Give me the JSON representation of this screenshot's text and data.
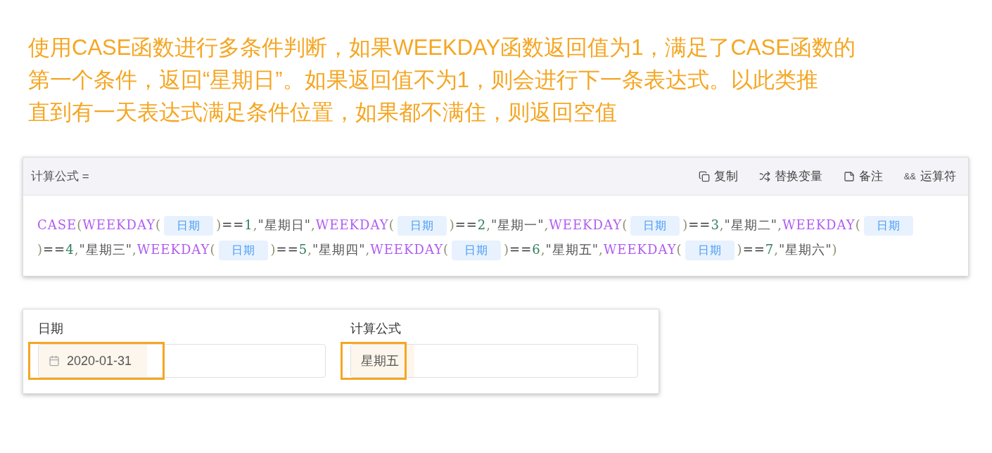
{
  "headline": [
    "使用CASE函数进行多条件判断，如果WEEKDAY函数返回值为1，满足了CASE函数的",
    "第一个条件，返回“星期日”。如果返回值不为1，则会进行下一条表达式。以此类推",
    "直到有一天表达式满足条件位置，如果都不满住，则返回空值"
  ],
  "formula_editor": {
    "title": "计算公式 =",
    "actions": [
      {
        "kind": "copy",
        "label": "复制"
      },
      {
        "kind": "replace",
        "label": "替换变量"
      },
      {
        "kind": "note",
        "label": "备注"
      },
      {
        "kind": "operator",
        "label": "运算符",
        "icon_text": "&&"
      }
    ],
    "tokens": [
      {
        "kind": "func",
        "text": "CASE"
      },
      {
        "kind": "punct",
        "text": "("
      },
      {
        "kind": "func",
        "text": "WEEKDAY"
      },
      {
        "kind": "punct",
        "text": "("
      },
      {
        "kind": "field",
        "text": "日期"
      },
      {
        "kind": "punct",
        "text": ")"
      },
      {
        "kind": "op",
        "text": "=="
      },
      {
        "kind": "num",
        "text": "1"
      },
      {
        "kind": "punct",
        "text": ","
      },
      {
        "kind": "str",
        "text": "\"星期日\""
      },
      {
        "kind": "punct",
        "text": ","
      },
      {
        "kind": "func",
        "text": "WEEKDAY"
      },
      {
        "kind": "punct",
        "text": "("
      },
      {
        "kind": "field",
        "text": "日期"
      },
      {
        "kind": "punct",
        "text": ")"
      },
      {
        "kind": "op",
        "text": "=="
      },
      {
        "kind": "num",
        "text": "2"
      },
      {
        "kind": "punct",
        "text": ","
      },
      {
        "kind": "str",
        "text": "\"星期一\""
      },
      {
        "kind": "punct",
        "text": ","
      },
      {
        "kind": "func",
        "text": "WEEKDAY"
      },
      {
        "kind": "punct",
        "text": "("
      },
      {
        "kind": "field",
        "text": "日期"
      },
      {
        "kind": "punct",
        "text": ")"
      },
      {
        "kind": "op",
        "text": "=="
      },
      {
        "kind": "num",
        "text": "3"
      },
      {
        "kind": "punct",
        "text": ","
      },
      {
        "kind": "str",
        "text": "\"星期二\""
      },
      {
        "kind": "punct",
        "text": ","
      },
      {
        "kind": "func",
        "text": "WEEKDAY"
      },
      {
        "kind": "punct",
        "text": "("
      },
      {
        "kind": "field",
        "text": "日期"
      },
      {
        "kind": "punct",
        "text": ")"
      },
      {
        "kind": "op",
        "text": "=="
      },
      {
        "kind": "num",
        "text": "4"
      },
      {
        "kind": "punct",
        "text": ","
      },
      {
        "kind": "str",
        "text": "\"星期三\""
      },
      {
        "kind": "punct",
        "text": ","
      },
      {
        "kind": "func",
        "text": "WEEKDAY"
      },
      {
        "kind": "punct",
        "text": "("
      },
      {
        "kind": "field",
        "text": "日期"
      },
      {
        "kind": "punct",
        "text": ")"
      },
      {
        "kind": "op",
        "text": "=="
      },
      {
        "kind": "num",
        "text": "5"
      },
      {
        "kind": "punct",
        "text": ","
      },
      {
        "kind": "str",
        "text": "\"星期四\""
      },
      {
        "kind": "punct",
        "text": ","
      },
      {
        "kind": "func",
        "text": "WEEKDAY"
      },
      {
        "kind": "punct",
        "text": "("
      },
      {
        "kind": "field",
        "text": "日期"
      },
      {
        "kind": "punct",
        "text": ")"
      },
      {
        "kind": "op",
        "text": "=="
      },
      {
        "kind": "num",
        "text": "6"
      },
      {
        "kind": "punct",
        "text": ","
      },
      {
        "kind": "str",
        "text": "\"星期五\""
      },
      {
        "kind": "punct",
        "text": ","
      },
      {
        "kind": "func",
        "text": "WEEKDAY"
      },
      {
        "kind": "punct",
        "text": "("
      },
      {
        "kind": "field",
        "text": "日期"
      },
      {
        "kind": "punct",
        "text": ")"
      },
      {
        "kind": "op",
        "text": "=="
      },
      {
        "kind": "num",
        "text": "7"
      },
      {
        "kind": "punct",
        "text": ","
      },
      {
        "kind": "str",
        "text": "\"星期六\""
      },
      {
        "kind": "punct",
        "text": ")"
      }
    ]
  },
  "form": {
    "fields": [
      {
        "kind": "date",
        "label": "日期",
        "value": "2020-01-31",
        "highlighted": true
      },
      {
        "kind": "text",
        "label": "计算公式",
        "value": "星期五",
        "highlighted": true
      }
    ]
  }
}
